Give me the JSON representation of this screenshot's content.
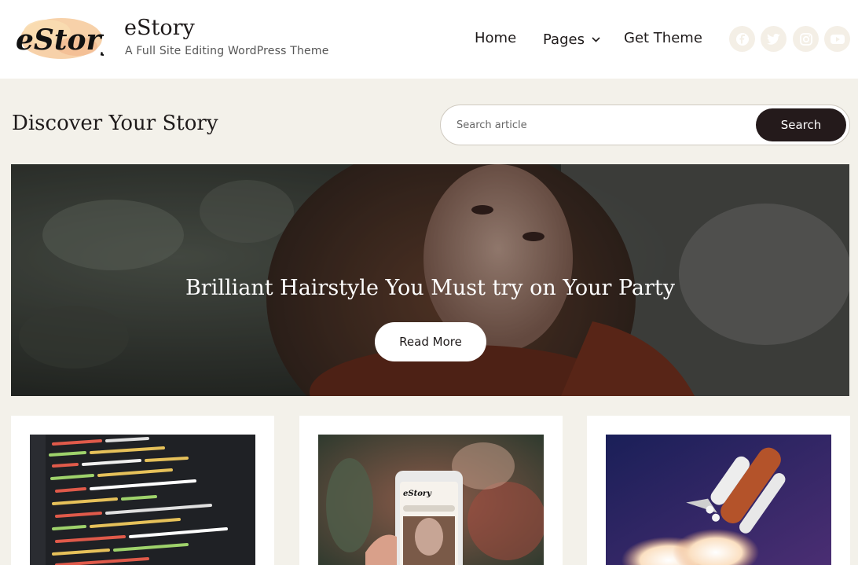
{
  "site": {
    "logo_text": "eStory",
    "title": "eStory",
    "tagline": "A Full Site Editing WordPress Theme"
  },
  "nav": {
    "home": "Home",
    "pages": "Pages",
    "get_theme": "Get Theme"
  },
  "social": [
    "facebook-icon",
    "twitter-icon",
    "instagram-icon",
    "youtube-icon"
  ],
  "discover": {
    "heading": "Discover Your Story"
  },
  "search": {
    "placeholder": "Search article",
    "button_label": "Search"
  },
  "hero": {
    "title": "Brilliant Hairstyle You Must try on Your Party",
    "button_label": "Read More"
  },
  "phone_logo": "eStory",
  "colors": {
    "background": "#f3f1ea",
    "header": "#ffffff",
    "dark_button": "#241a1b",
    "social_bg": "#f4efe6"
  }
}
